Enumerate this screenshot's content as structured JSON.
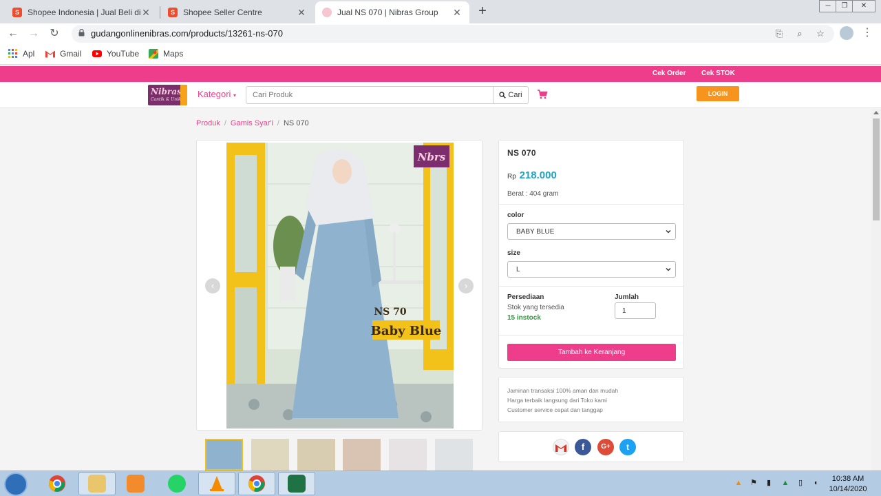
{
  "browser": {
    "tabs": [
      {
        "title": "Shopee Indonesia | Jual Beli di Po",
        "active": false
      },
      {
        "title": "Shopee Seller Centre",
        "active": false
      },
      {
        "title": "Jual NS 070 | Nibras Group",
        "active": true
      }
    ],
    "url": "gudangonlinenibras.com/products/13261-ns-070",
    "bookmarks": [
      "Apl",
      "Gmail",
      "YouTube",
      "Maps"
    ]
  },
  "site": {
    "topbar_links": [
      "Cek Order",
      "Cek STOK"
    ],
    "logo_text": "Nibras",
    "logo_tagline": "Cantik & Unik",
    "kategori_label": "Kategori",
    "search_placeholder": "Cari Produk",
    "search_button": "Cari",
    "login_label": "LOGIN"
  },
  "breadcrumb": [
    "Produk",
    "Gamis Syar'i",
    "NS 070"
  ],
  "product": {
    "name": "NS 070",
    "currency": "Rp",
    "price": "218.000",
    "weight": "Berat : 404 gram",
    "color_label": "color",
    "color_value": "BABY BLUE",
    "size_label": "size",
    "size_value": "L",
    "stock_label": "Persediaan",
    "stock_sub": "Stok yang tersedia",
    "stock_value": "15 instock",
    "qty_label": "Jumlah",
    "qty_value": "1",
    "add_to_cart": "Tambah ke Keranjang",
    "image_brand": "Nbrs",
    "image_code": "NS 70",
    "image_color": "Baby Blue"
  },
  "guarantees": [
    "Jaminan transaksi 100% aman dan mudah",
    "Harga terbaik langsung dari Toko kami",
    "Customer service cepat dan tanggap"
  ],
  "share": [
    "gmail",
    "facebook",
    "google-plus",
    "twitter"
  ],
  "taskbar": {
    "time": "10:38 AM",
    "date": "10/14/2020"
  },
  "colors": {
    "brand_pink": "#ee3d8a",
    "price_blue": "#1fa2c7",
    "login_orange": "#f7941d",
    "stock_green": "#2a9d3a"
  }
}
